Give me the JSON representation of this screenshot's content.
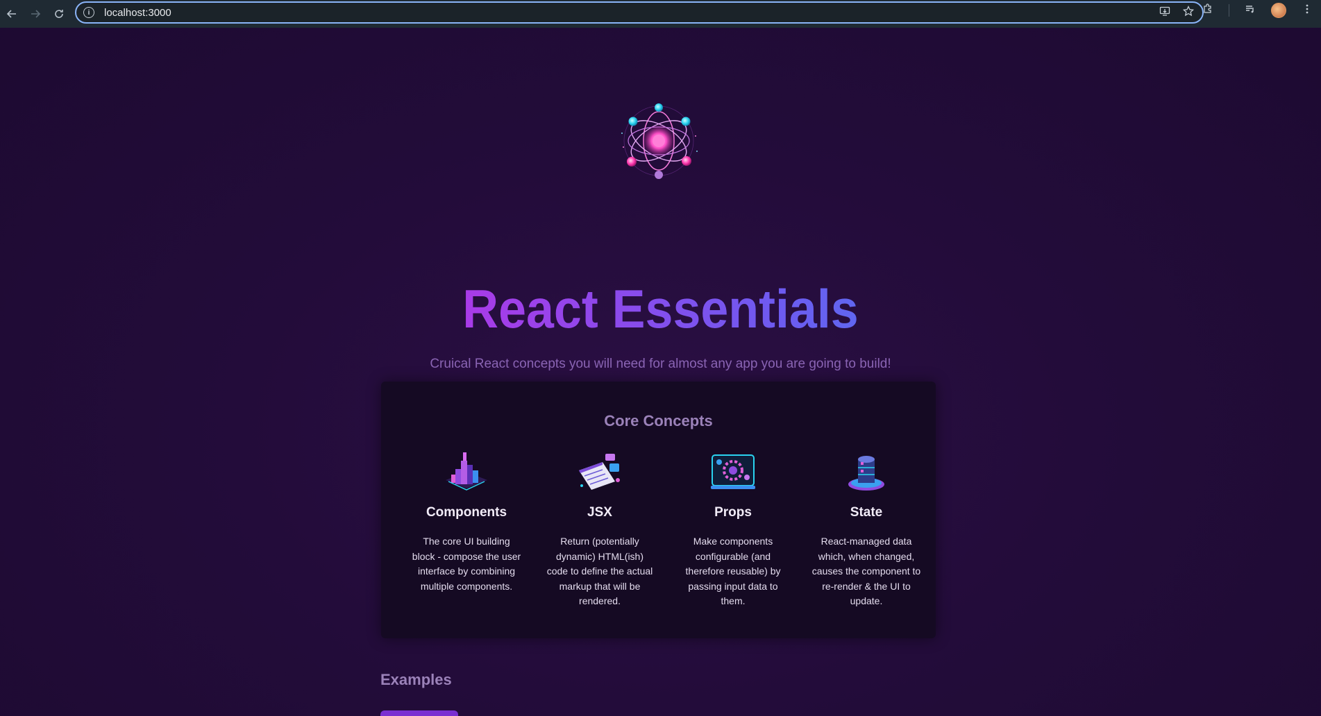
{
  "browser": {
    "url": "localhost:3000",
    "back_icon": "arrow-left-icon",
    "forward_icon": "arrow-right-icon",
    "reload_icon": "reload-icon"
  },
  "header": {
    "title": "React Essentials",
    "subtitle": "Cruical React concepts you will need for almost any app you are going to build!"
  },
  "core_concepts": {
    "heading": "Core Concepts",
    "items": [
      {
        "title": "Components",
        "description": "The core UI building block - compose the user interface by combining multiple components.",
        "icon": "components-image"
      },
      {
        "title": "JSX",
        "description": "Return (potentially dynamic) HTML(ish) code to define the actual markup that will be rendered.",
        "icon": "jsx-image"
      },
      {
        "title": "Props",
        "description": "Make components configurable (and therefore reusable) by passing input data to them.",
        "icon": "props-image"
      },
      {
        "title": "State",
        "description": "React-managed data which, when changed, causes the component to re-render & the UI to update.",
        "icon": "state-image"
      }
    ]
  },
  "examples": {
    "heading": "Examples"
  },
  "colors": {
    "background": "#230c3a",
    "card": "#150a23",
    "title_gradient_start": "#e11ae0",
    "title_gradient_end": "#1aa3f0",
    "subtitle": "#8a64b4",
    "tab_accent": "#7a2fd1"
  }
}
